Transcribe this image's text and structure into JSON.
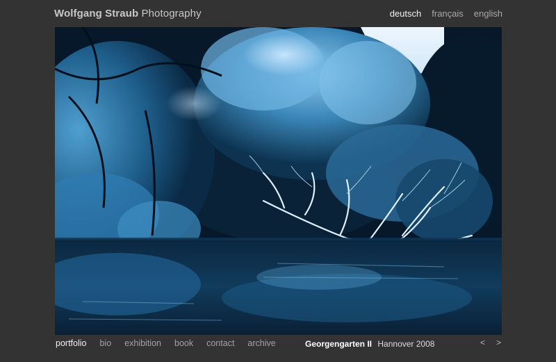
{
  "header": {
    "name": "Wolfgang Straub",
    "suffix": "Photography"
  },
  "languages": [
    {
      "label": "deutsch",
      "active": true
    },
    {
      "label": "français",
      "active": false
    },
    {
      "label": "english",
      "active": false
    }
  ],
  "nav": [
    {
      "label": "portfolio",
      "active": true
    },
    {
      "label": "bio"
    },
    {
      "label": "exhibition"
    },
    {
      "label": "book"
    },
    {
      "label": "contact"
    },
    {
      "label": "archive"
    }
  ],
  "caption": {
    "title": "Georgengarten II",
    "place_year": "Hannover 2008"
  },
  "pager": {
    "prev": "<",
    "next": ">"
  },
  "colors": {
    "background": "#333333",
    "photo_tint": "#2a6a9a"
  }
}
